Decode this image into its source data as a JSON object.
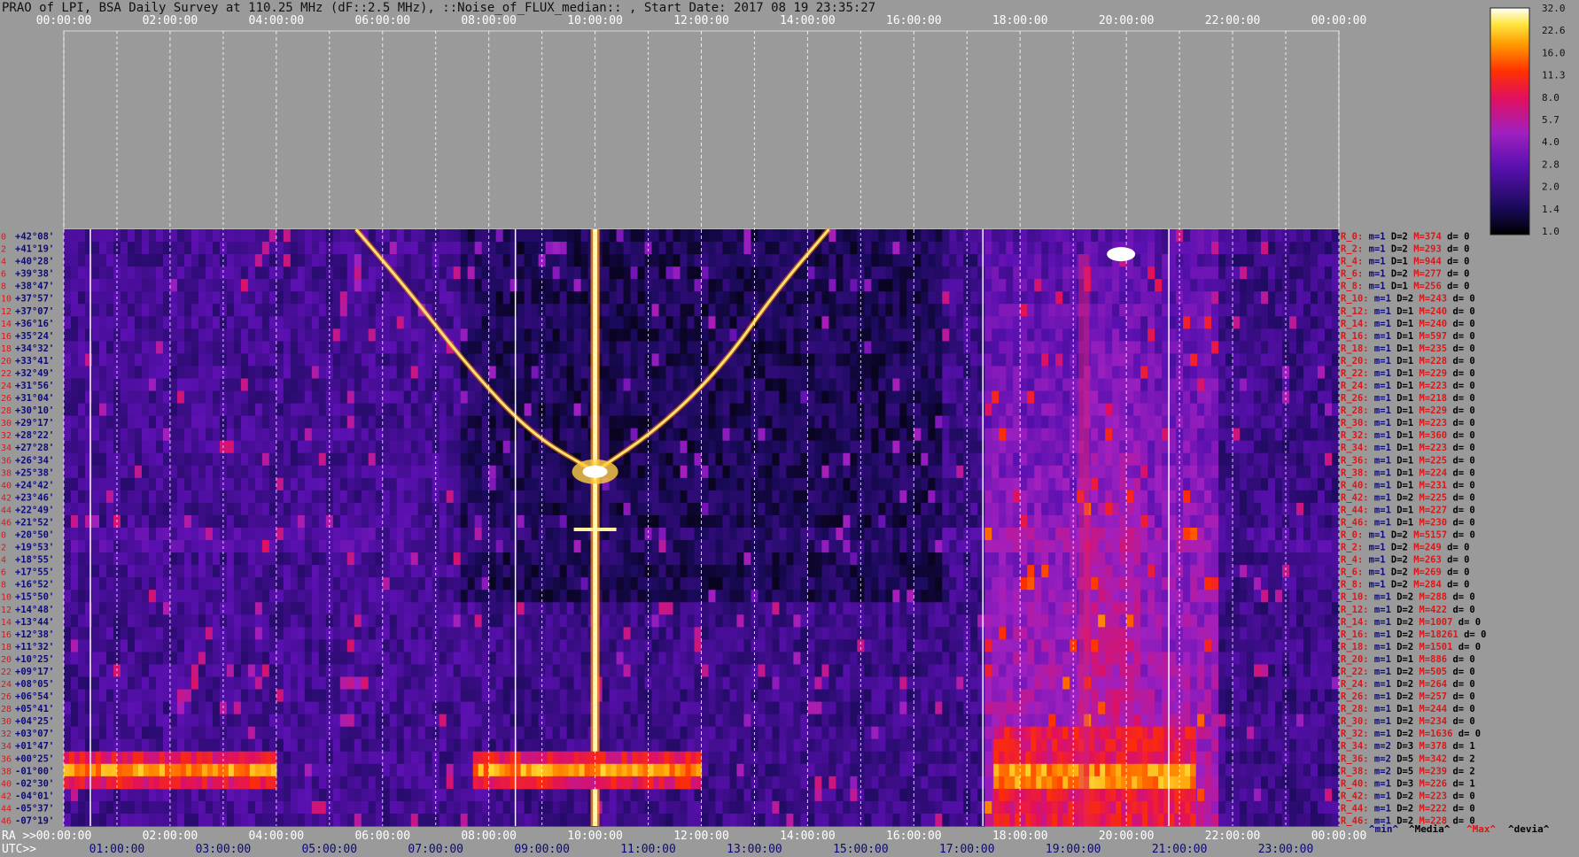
{
  "title": "PRAO of LPI, BSA Daily Survey at 110.25 MHz (dF::2.5 MHz), ::Noise_of_FLUX_median:: , Start Date: 2017 08 19 23:35:27",
  "colors": {
    "background": "#9a9a9a",
    "red": "#d81818",
    "navy": "#0a0a7a",
    "black": "#000000"
  },
  "chart_data": {
    "type": "heatmap",
    "title": "PRAO of LPI, BSA Daily Survey at 110.25 MHz (dF::2.5 MHz), ::Noise_of_FLUX_median:: , Start Date: 2017 08 19 23:35:27",
    "xlabel_bottom_ra": "RA >>",
    "xlabel_bottom_utc": "UTC>>",
    "x_range_hours": [
      0,
      24
    ],
    "top_ticks": [
      "00:00:00",
      "02:00:00",
      "04:00:00",
      "06:00:00",
      "08:00:00",
      "10:00:00",
      "12:00:00",
      "14:00:00",
      "16:00:00",
      "18:00:00",
      "20:00:00",
      "22:00:00",
      "00:00:00"
    ],
    "ra_ticks": [
      "00:00:00",
      "02:00:00",
      "04:00:00",
      "06:00:00",
      "08:00:00",
      "10:00:00",
      "12:00:00",
      "14:00:00",
      "16:00:00",
      "18:00:00",
      "20:00:00",
      "22:00:00",
      "00:00:00"
    ],
    "utc_ticks": [
      "01:00:00",
      "03:00:00",
      "05:00:00",
      "07:00:00",
      "09:00:00",
      "11:00:00",
      "13:00:00",
      "15:00:00",
      "17:00:00",
      "19:00:00",
      "21:00:00",
      "23:00:00"
    ],
    "declinations": [
      "+42°08'",
      "+41°19'",
      "+40°28'",
      "+39°38'",
      "+38°47'",
      "+37°57'",
      "+37°07'",
      "+36°16'",
      "+35°24'",
      "+34°32'",
      "+33°41'",
      "+32°49'",
      "+31°56'",
      "+31°04'",
      "+30°10'",
      "+29°17'",
      "+28°22'",
      "+27°28'",
      "+26°34'",
      "+25°38'",
      "+24°42'",
      "+23°46'",
      "+22°49'",
      "+21°52'",
      "+20°50'",
      "+19°53'",
      "+18°55'",
      "+17°55'",
      "+16°52'",
      "+15°50'",
      "+14°48'",
      "+13°44'",
      "+12°38'",
      "+11°32'",
      "+10°25'",
      "+09°17'",
      "+08°05'",
      "+06°54'",
      "+05°41'",
      "+04°25'",
      "+03°07'",
      "+01°47'",
      "+00°25'",
      "-01°00'",
      "-02°30'",
      "-04°01'",
      "-05°37'",
      "-07°19'"
    ],
    "row_numbers": [
      "0",
      "2",
      "4",
      "6",
      "8",
      "10",
      "12",
      "14",
      "16",
      "18",
      "20",
      "22",
      "24",
      "26",
      "28",
      "30",
      "32",
      "34",
      "36",
      "38",
      "40",
      "42",
      "44",
      "46",
      "0",
      "2",
      "4",
      "6",
      "8",
      "10",
      "12",
      "14",
      "16",
      "18",
      "20",
      "22",
      "24",
      "26",
      "28",
      "30",
      "32",
      "34",
      "36",
      "38",
      "40",
      "42",
      "44",
      "46"
    ],
    "row_stats": [
      {
        "r": "R_0:",
        "m": "m=1",
        "D": "D=2",
        "M": "M=374",
        "d": "d= 0"
      },
      {
        "r": "R_2:",
        "m": "m=1",
        "D": "D=2",
        "M": "M=293",
        "d": "d= 0"
      },
      {
        "r": "R_4:",
        "m": "m=1",
        "D": "D=1",
        "M": "M=944",
        "d": "d= 0"
      },
      {
        "r": "R_6:",
        "m": "m=1",
        "D": "D=2",
        "M": "M=277",
        "d": "d= 0"
      },
      {
        "r": "R_8:",
        "m": "m=1",
        "D": "D=1",
        "M": "M=256",
        "d": "d= 0"
      },
      {
        "r": "R_10:",
        "m": "m=1",
        "D": "D=2",
        "M": "M=243",
        "d": "d= 0"
      },
      {
        "r": "R_12:",
        "m": "m=1",
        "D": "D=1",
        "M": "M=240",
        "d": "d= 0"
      },
      {
        "r": "R_14:",
        "m": "m=1",
        "D": "D=1",
        "M": "M=240",
        "d": "d= 0"
      },
      {
        "r": "R_16:",
        "m": "m=1",
        "D": "D=1",
        "M": "M=597",
        "d": "d= 0"
      },
      {
        "r": "R_18:",
        "m": "m=1",
        "D": "D=1",
        "M": "M=235",
        "d": "d= 0"
      },
      {
        "r": "R_20:",
        "m": "m=1",
        "D": "D=1",
        "M": "M=228",
        "d": "d= 0"
      },
      {
        "r": "R_22:",
        "m": "m=1",
        "D": "D=1",
        "M": "M=229",
        "d": "d= 0"
      },
      {
        "r": "R_24:",
        "m": "m=1",
        "D": "D=1",
        "M": "M=223",
        "d": "d= 0"
      },
      {
        "r": "R_26:",
        "m": "m=1",
        "D": "D=1",
        "M": "M=218",
        "d": "d= 0"
      },
      {
        "r": "R_28:",
        "m": "m=1",
        "D": "D=1",
        "M": "M=229",
        "d": "d= 0"
      },
      {
        "r": "R_30:",
        "m": "m=1",
        "D": "D=1",
        "M": "M=223",
        "d": "d= 0"
      },
      {
        "r": "R_32:",
        "m": "m=1",
        "D": "D=1",
        "M": "M=360",
        "d": "d= 0"
      },
      {
        "r": "R_34:",
        "m": "m=1",
        "D": "D=1",
        "M": "M=223",
        "d": "d= 0"
      },
      {
        "r": "R_36:",
        "m": "m=1",
        "D": "D=1",
        "M": "M=225",
        "d": "d= 0"
      },
      {
        "r": "R_38:",
        "m": "m=1",
        "D": "D=1",
        "M": "M=224",
        "d": "d= 0"
      },
      {
        "r": "R_40:",
        "m": "m=1",
        "D": "D=1",
        "M": "M=231",
        "d": "d= 0"
      },
      {
        "r": "R_42:",
        "m": "m=1",
        "D": "D=2",
        "M": "M=225",
        "d": "d= 0"
      },
      {
        "r": "R_44:",
        "m": "m=1",
        "D": "D=1",
        "M": "M=227",
        "d": "d= 0"
      },
      {
        "r": "R_46:",
        "m": "m=1",
        "D": "D=1",
        "M": "M=230",
        "d": "d= 0"
      },
      {
        "r": "R_0:",
        "m": "m=1",
        "D": "D=2",
        "M": "M=5157",
        "d": "d= 0"
      },
      {
        "r": "R_2:",
        "m": "m=1",
        "D": "D=2",
        "M": "M=249",
        "d": "d= 0"
      },
      {
        "r": "R_4:",
        "m": "m=1",
        "D": "D=2",
        "M": "M=263",
        "d": "d= 0"
      },
      {
        "r": "R_6:",
        "m": "m=1",
        "D": "D=2",
        "M": "M=269",
        "d": "d= 0"
      },
      {
        "r": "R_8:",
        "m": "m=1",
        "D": "D=2",
        "M": "M=284",
        "d": "d= 0"
      },
      {
        "r": "R_10:",
        "m": "m=1",
        "D": "D=2",
        "M": "M=288",
        "d": "d= 0"
      },
      {
        "r": "R_12:",
        "m": "m=1",
        "D": "D=2",
        "M": "M=422",
        "d": "d= 0"
      },
      {
        "r": "R_14:",
        "m": "m=1",
        "D": "D=2",
        "M": "M=1007",
        "d": "d= 0"
      },
      {
        "r": "R_16:",
        "m": "m=1",
        "D": "D=2",
        "M": "M=18261",
        "d": "d= 0"
      },
      {
        "r": "R_18:",
        "m": "m=1",
        "D": "D=2",
        "M": "M=1501",
        "d": "d= 0"
      },
      {
        "r": "R_20:",
        "m": "m=1",
        "D": "D=1",
        "M": "M=886",
        "d": "d= 0"
      },
      {
        "r": "R_22:",
        "m": "m=1",
        "D": "D=2",
        "M": "M=505",
        "d": "d= 0"
      },
      {
        "r": "R_24:",
        "m": "m=1",
        "D": "D=2",
        "M": "M=264",
        "d": "d= 0"
      },
      {
        "r": "R_26:",
        "m": "m=1",
        "D": "D=2",
        "M": "M=257",
        "d": "d= 0"
      },
      {
        "r": "R_28:",
        "m": "m=1",
        "D": "D=1",
        "M": "M=244",
        "d": "d= 0"
      },
      {
        "r": "R_30:",
        "m": "m=1",
        "D": "D=2",
        "M": "M=234",
        "d": "d= 0"
      },
      {
        "r": "R_32:",
        "m": "m=1",
        "D": "D=2",
        "M": "M=1636",
        "d": "d= 0"
      },
      {
        "r": "R_34:",
        "m": "m=2",
        "D": "D=3",
        "M": "M=378",
        "d": "d= 1"
      },
      {
        "r": "R_36:",
        "m": "m=2",
        "D": "D=5",
        "M": "M=342",
        "d": "d= 2"
      },
      {
        "r": "R_38:",
        "m": "m=2",
        "D": "D=5",
        "M": "M=239",
        "d": "d= 2"
      },
      {
        "r": "R_40:",
        "m": "m=1",
        "D": "D=3",
        "M": "M=226",
        "d": "d= 1"
      },
      {
        "r": "R_42:",
        "m": "m=1",
        "D": "D=2",
        "M": "M=223",
        "d": "d= 0"
      },
      {
        "r": "R_44:",
        "m": "m=1",
        "D": "D=2",
        "M": "M=222",
        "d": "d= 0"
      },
      {
        "r": "R_46:",
        "m": "m=1",
        "D": "D=2",
        "M": "M=228",
        "d": "d= 0"
      }
    ],
    "stats_legend": [
      "^min^",
      "^Media^",
      "^Max^",
      "^devia^"
    ],
    "colorbar_ticks": [
      "32.0",
      "22.6",
      "16.0",
      "11.3",
      "8.0",
      "5.7",
      "4.0",
      "2.8",
      "2.0",
      "1.4",
      "1.0"
    ],
    "colorbar_scale": "log",
    "colorbar_range": [
      1.0,
      32.0
    ],
    "features": [
      {
        "name": "left-arc",
        "type": "arc",
        "points": [
          [
            5.5,
            0
          ],
          [
            6.5,
            5
          ],
          [
            7.6,
            11
          ],
          [
            8.8,
            16.5
          ],
          [
            10.0,
            19.5
          ]
        ]
      },
      {
        "name": "right-arc",
        "type": "arc",
        "points": [
          [
            10.0,
            19.5
          ],
          [
            11.2,
            16
          ],
          [
            12.4,
            11
          ],
          [
            13.4,
            5
          ],
          [
            14.4,
            0
          ]
        ]
      },
      {
        "name": "vertical-source",
        "type": "vline",
        "x": 10.0
      },
      {
        "name": "night-band-1",
        "type": "band",
        "x": [
          0,
          4.0
        ],
        "rows": [
          42,
          44
        ]
      },
      {
        "name": "night-band-2",
        "type": "band",
        "x": [
          7.7,
          12.0
        ],
        "rows": [
          42,
          44
        ]
      },
      {
        "name": "night-band-3",
        "type": "band",
        "x": [
          17.5,
          21.3
        ],
        "rows": [
          40,
          47
        ]
      },
      {
        "name": "evening-rise",
        "type": "ramp",
        "x": [
          17.3,
          21.5
        ]
      }
    ]
  }
}
